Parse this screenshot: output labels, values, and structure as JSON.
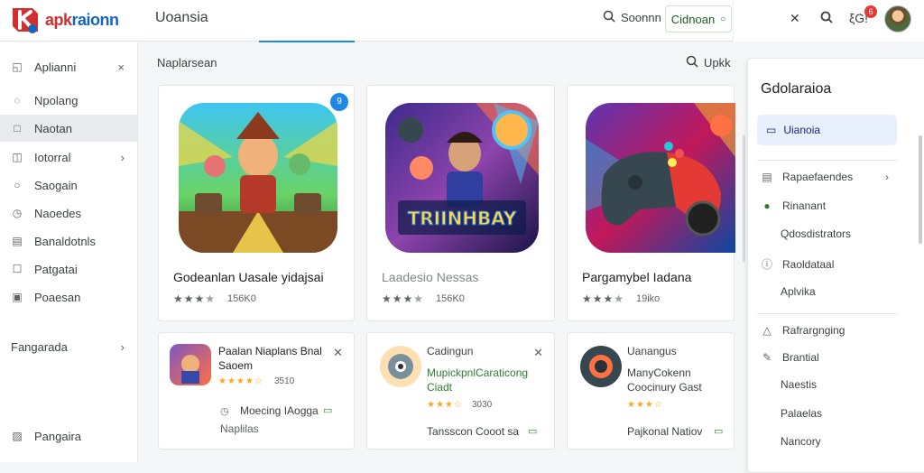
{
  "header": {
    "logo_text_a": "apk",
    "logo_text_b": "raionn",
    "app_title": "Uoansia",
    "search_label": "Soonnn",
    "outlined_button_label": "Cidnoan",
    "notification_count": "6",
    "tool_text": "ξG!"
  },
  "sidebar": {
    "items": [
      {
        "label": "Aplianni",
        "icon": "bookmark-icon",
        "trail": "×"
      },
      {
        "label": "Npolang",
        "icon": "lightbulb-icon",
        "trail": ""
      },
      {
        "label": "Naotan",
        "icon": "square-icon",
        "trail": ""
      },
      {
        "label": "Iotorral",
        "icon": "tag-icon",
        "trail": "›"
      },
      {
        "label": "Saogain",
        "icon": "circle-icon",
        "trail": ""
      },
      {
        "label": "Naoedes",
        "icon": "clock-icon",
        "trail": ""
      },
      {
        "label": "Banaldotnls",
        "icon": "list-icon",
        "trail": ""
      },
      {
        "label": "Patgatai",
        "icon": "box-icon",
        "trail": ""
      },
      {
        "label": "Poaesan",
        "icon": "doc-icon",
        "trail": ""
      }
    ],
    "group_label": "Fangarada",
    "group_trail": "›",
    "footer_label": "Pangaira"
  },
  "main": {
    "section_title": "Naplarsean",
    "search_label": "Upkk",
    "featured": [
      {
        "title": "Godeanlan Uasale yidajsai",
        "rating": 3,
        "count": "156K0"
      },
      {
        "title": "Laadesio Nessas",
        "rating": 3,
        "count": "156K0",
        "art_text": "TRIINHBAY"
      },
      {
        "title": "Pargamybel Iadana",
        "rating": 3,
        "count": "19iko"
      }
    ],
    "mini": [
      {
        "title": "Paalan Niaplans Bnal Saoem",
        "sub": "",
        "count": "3510",
        "action": "Moecing IAogga",
        "action_sub": "Naplilas"
      },
      {
        "title": "Cadingun",
        "sub": "MupickpnlCaraticong Ciadt",
        "count": "3030",
        "action": "Tansscon Cooot sa"
      },
      {
        "title": "Uanangus",
        "sub": "ManyCokenn Coocinury Gast",
        "count": "",
        "action": "Pajkonal Natiov"
      }
    ]
  },
  "panel": {
    "title": "Gdolaraioa",
    "selected": "Uianoia",
    "rows": [
      {
        "label": "Rapaefaendes",
        "icon": "list-icon",
        "chevron": "›"
      },
      {
        "label": "Rinanant",
        "icon": "check-circle-icon"
      },
      {
        "label": "Qdosdistrators",
        "icon": ""
      },
      {
        "label": "Raoldataal",
        "icon": "info-icon"
      },
      {
        "label": "Aplvika",
        "icon": ""
      }
    ],
    "rows2": [
      {
        "label": "Rafrargnging",
        "icon": "triangle-icon"
      },
      {
        "label": "Brantial",
        "icon": "pencil-icon"
      },
      {
        "label": "Naestis",
        "icon": ""
      },
      {
        "label": "Palaelas",
        "icon": ""
      },
      {
        "label": "Nancory",
        "icon": ""
      }
    ]
  },
  "colors": {
    "accent": "#1e88e5",
    "green": "#2e7d32",
    "active_bg": "#e8eaed",
    "panel_selected": "#e8f0fe"
  }
}
